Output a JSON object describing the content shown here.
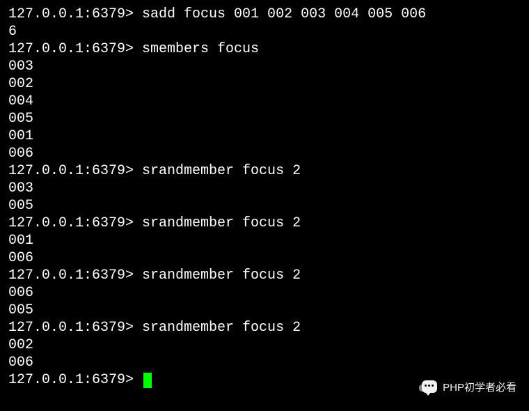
{
  "prompt": "127.0.0.1:6379>",
  "lines": [
    {
      "type": "cmd",
      "command": "sadd focus 001 002 003 004 005 006"
    },
    {
      "type": "out",
      "text": "6"
    },
    {
      "type": "cmd",
      "command": "smembers focus"
    },
    {
      "type": "out",
      "text": "003"
    },
    {
      "type": "out",
      "text": "002"
    },
    {
      "type": "out",
      "text": "004"
    },
    {
      "type": "out",
      "text": "005"
    },
    {
      "type": "out",
      "text": "001"
    },
    {
      "type": "out",
      "text": "006"
    },
    {
      "type": "cmd",
      "command": "srandmember focus 2"
    },
    {
      "type": "out",
      "text": "003"
    },
    {
      "type": "out",
      "text": "005"
    },
    {
      "type": "cmd",
      "command": "srandmember focus 2"
    },
    {
      "type": "out",
      "text": "001"
    },
    {
      "type": "out",
      "text": "006"
    },
    {
      "type": "cmd",
      "command": "srandmember focus 2"
    },
    {
      "type": "out",
      "text": "006"
    },
    {
      "type": "out",
      "text": "005"
    },
    {
      "type": "cmd",
      "command": "srandmember focus 2"
    },
    {
      "type": "out",
      "text": "002"
    },
    {
      "type": "out",
      "text": "006"
    },
    {
      "type": "cursor"
    }
  ],
  "watermark": {
    "text": "PHP初学者必看"
  }
}
